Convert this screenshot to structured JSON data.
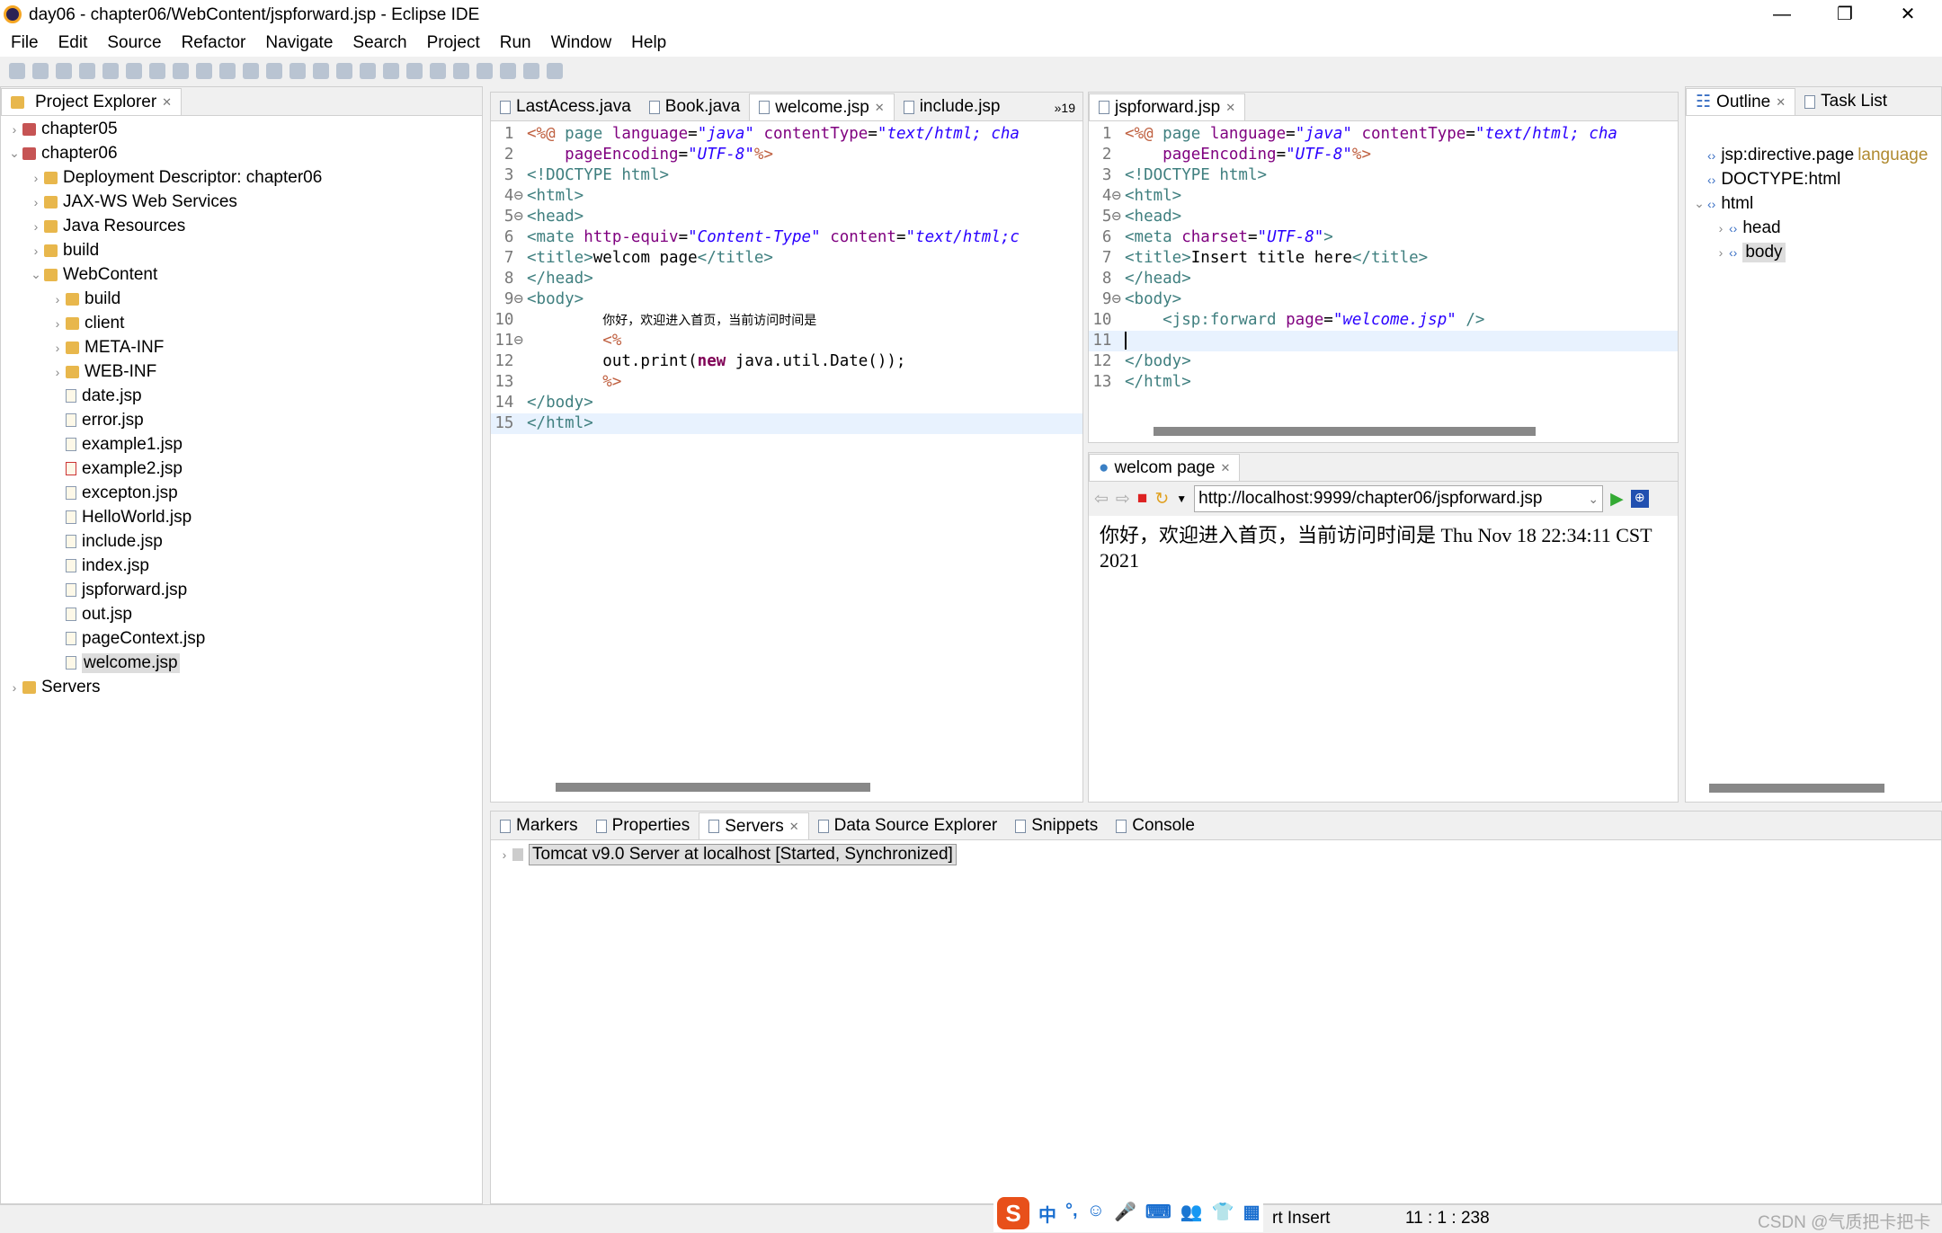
{
  "window": {
    "title": "day06 - chapter06/WebContent/jspforward.jsp - Eclipse IDE",
    "minimize": "—",
    "restore": "❐",
    "close": "✕"
  },
  "menu": [
    "File",
    "Edit",
    "Source",
    "Refactor",
    "Navigate",
    "Search",
    "Project",
    "Run",
    "Window",
    "Help"
  ],
  "project_explorer": {
    "title": "Project Explorer",
    "items": [
      {
        "label": "chapter05",
        "depth": 0,
        "twisty": "›",
        "icon": "proj"
      },
      {
        "label": "chapter06",
        "depth": 0,
        "twisty": "⌄",
        "icon": "proj"
      },
      {
        "label": "Deployment Descriptor: chapter06",
        "depth": 1,
        "twisty": "›",
        "icon": "dd"
      },
      {
        "label": "JAX-WS Web Services",
        "depth": 1,
        "twisty": "›",
        "icon": "ws"
      },
      {
        "label": "Java Resources",
        "depth": 1,
        "twisty": "›",
        "icon": "folder"
      },
      {
        "label": "build",
        "depth": 1,
        "twisty": "›",
        "icon": "folder"
      },
      {
        "label": "WebContent",
        "depth": 1,
        "twisty": "⌄",
        "icon": "folder"
      },
      {
        "label": "build",
        "depth": 2,
        "twisty": "›",
        "icon": "folder"
      },
      {
        "label": "client",
        "depth": 2,
        "twisty": "›",
        "icon": "folder"
      },
      {
        "label": "META-INF",
        "depth": 2,
        "twisty": "›",
        "icon": "folder"
      },
      {
        "label": "WEB-INF",
        "depth": 2,
        "twisty": "›",
        "icon": "folder"
      },
      {
        "label": "date.jsp",
        "depth": 2,
        "twisty": "",
        "icon": "jsp"
      },
      {
        "label": "error.jsp",
        "depth": 2,
        "twisty": "",
        "icon": "jsp"
      },
      {
        "label": "example1.jsp",
        "depth": 2,
        "twisty": "",
        "icon": "jsp"
      },
      {
        "label": "example2.jsp",
        "depth": 2,
        "twisty": "",
        "icon": "jsperr"
      },
      {
        "label": "excepton.jsp",
        "depth": 2,
        "twisty": "",
        "icon": "jsp"
      },
      {
        "label": "HelloWorld.jsp",
        "depth": 2,
        "twisty": "",
        "icon": "jsp"
      },
      {
        "label": "include.jsp",
        "depth": 2,
        "twisty": "",
        "icon": "jsp"
      },
      {
        "label": "index.jsp",
        "depth": 2,
        "twisty": "",
        "icon": "jsp"
      },
      {
        "label": "jspforward.jsp",
        "depth": 2,
        "twisty": "",
        "icon": "jsp"
      },
      {
        "label": "out.jsp",
        "depth": 2,
        "twisty": "",
        "icon": "jsp"
      },
      {
        "label": "pageContext.jsp",
        "depth": 2,
        "twisty": "",
        "icon": "jsp"
      },
      {
        "label": "welcome.jsp",
        "depth": 2,
        "twisty": "",
        "icon": "jsp",
        "selected": true
      },
      {
        "label": "Servers",
        "depth": 0,
        "twisty": "›",
        "icon": "folder"
      }
    ]
  },
  "editor1": {
    "tabs": [
      {
        "label": "LastAcess.java"
      },
      {
        "label": "Book.java"
      },
      {
        "label": "welcome.jsp",
        "active": true,
        "closable": true
      },
      {
        "label": "include.jsp"
      }
    ],
    "overflow": "»19",
    "current_line": 15,
    "lines": [
      [
        [
          "jsp",
          "<%@ "
        ],
        [
          "tag",
          "page "
        ],
        [
          "attr",
          "language"
        ],
        [
          "txt",
          "="
        ],
        [
          "val",
          "\"java\""
        ],
        [
          "txt",
          " "
        ],
        [
          "attr",
          "contentType"
        ],
        [
          "txt",
          "="
        ],
        [
          "val",
          "\"text/html; cha"
        ]
      ],
      [
        [
          "txt",
          "    "
        ],
        [
          "attr",
          "pageEncoding"
        ],
        [
          "txt",
          "="
        ],
        [
          "val",
          "\"UTF-8\""
        ],
        [
          "jsp",
          "%>"
        ]
      ],
      [
        [
          "tag",
          "<!DOCTYPE html>"
        ]
      ],
      [
        [
          "tag",
          "<html>"
        ]
      ],
      [
        [
          "tag",
          "<head>"
        ]
      ],
      [
        [
          "tag",
          "<mate "
        ],
        [
          "attr",
          "http-equiv"
        ],
        [
          "txt",
          "="
        ],
        [
          "val",
          "\"Content-Type\""
        ],
        [
          "txt",
          " "
        ],
        [
          "attr",
          "content"
        ],
        [
          "txt",
          "="
        ],
        [
          "val",
          "\"text/html;c"
        ]
      ],
      [
        [
          "tag",
          "<title>"
        ],
        [
          "txt",
          "welcom page"
        ],
        [
          "tag",
          "</title>"
        ]
      ],
      [
        [
          "tag",
          "</head>"
        ]
      ],
      [
        [
          "tag",
          "<body>"
        ]
      ],
      [
        [
          "txt",
          "        "
        ],
        [
          "cn",
          "你好，欢迎进入首页，当前访问时间是"
        ]
      ],
      [
        [
          "txt",
          "        "
        ],
        [
          "jsp",
          "<%"
        ]
      ],
      [
        [
          "txt",
          "        out.print("
        ],
        [
          "kw",
          "new"
        ],
        [
          "txt",
          " java.util.Date());"
        ]
      ],
      [
        [
          "txt",
          "        "
        ],
        [
          "jsp",
          "%>"
        ]
      ],
      [
        [
          "tag",
          "</body>"
        ]
      ],
      [
        [
          "tag",
          "</html>"
        ]
      ]
    ]
  },
  "editor2": {
    "tabs": [
      {
        "label": "jspforward.jsp",
        "active": true,
        "closable": true
      }
    ],
    "current_line": 11,
    "lines": [
      [
        [
          "jsp",
          "<%@ "
        ],
        [
          "tag",
          "page "
        ],
        [
          "attr",
          "language"
        ],
        [
          "txt",
          "="
        ],
        [
          "val",
          "\"java\""
        ],
        [
          "txt",
          " "
        ],
        [
          "attr",
          "contentType"
        ],
        [
          "txt",
          "="
        ],
        [
          "val",
          "\"text/html; cha"
        ]
      ],
      [
        [
          "txt",
          "    "
        ],
        [
          "attr",
          "pageEncoding"
        ],
        [
          "txt",
          "="
        ],
        [
          "val",
          "\"UTF-8\""
        ],
        [
          "jsp",
          "%>"
        ]
      ],
      [
        [
          "tag",
          "<!DOCTYPE html>"
        ]
      ],
      [
        [
          "tag",
          "<html>"
        ]
      ],
      [
        [
          "tag",
          "<head>"
        ]
      ],
      [
        [
          "tag",
          "<meta "
        ],
        [
          "attr",
          "charset"
        ],
        [
          "txt",
          "="
        ],
        [
          "val",
          "\"UTF-8\""
        ],
        [
          "tag",
          ">"
        ]
      ],
      [
        [
          "tag",
          "<title>"
        ],
        [
          "txt",
          "Insert title here"
        ],
        [
          "tag",
          "</title>"
        ]
      ],
      [
        [
          "tag",
          "</head>"
        ]
      ],
      [
        [
          "tag",
          "<body>"
        ]
      ],
      [
        [
          "txt",
          "    "
        ],
        [
          "tag",
          "<jsp:forward "
        ],
        [
          "attr",
          "page"
        ],
        [
          "txt",
          "="
        ],
        [
          "val",
          "\"welcome.jsp\""
        ],
        [
          "txt",
          " "
        ],
        [
          "tag",
          "/>"
        ]
      ],
      [
        [
          "txt",
          ""
        ]
      ],
      [
        [
          "tag",
          "</body>"
        ]
      ],
      [
        [
          "tag",
          "</html>"
        ]
      ]
    ]
  },
  "browser": {
    "tab": "welcom page",
    "url": "http://localhost:9999/chapter06/jspforward.jsp",
    "content": "你好，欢迎进入首页，当前访问时间是 Thu Nov 18 22:34:11 CST 2021"
  },
  "outline": {
    "tabs": [
      "Outline",
      "Task List"
    ],
    "items": [
      {
        "label": "jsp:directive.page",
        "extra": "language",
        "depth": 0,
        "twisty": ""
      },
      {
        "label": "DOCTYPE:html",
        "depth": 0,
        "twisty": ""
      },
      {
        "label": "html",
        "depth": 0,
        "twisty": "⌄"
      },
      {
        "label": "head",
        "depth": 1,
        "twisty": "›"
      },
      {
        "label": "body",
        "depth": 1,
        "twisty": "›",
        "selected": true
      }
    ]
  },
  "bottom": {
    "tabs": [
      "Markers",
      "Properties",
      "Servers",
      "Data Source Explorer",
      "Snippets",
      "Console"
    ],
    "active": "Servers",
    "server": "Tomcat v9.0 Server at localhost  [Started, Synchronized]"
  },
  "status": {
    "mode": "rt Insert",
    "position": "11 : 1 : 238",
    "watermark": "CSDN @气质把卡把卡",
    "ime": [
      "中",
      "°,",
      "☺",
      "🎤",
      "⌨",
      "👥",
      "👕",
      "▦"
    ]
  }
}
